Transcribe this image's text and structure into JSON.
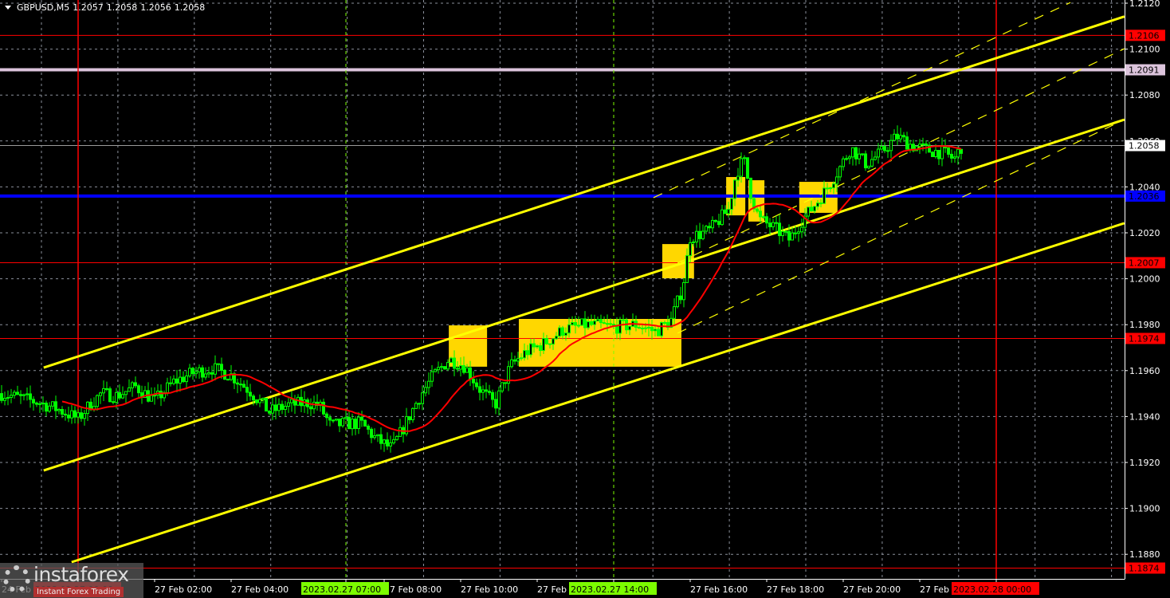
{
  "header": {
    "symbol": "GBPUSD,M5",
    "open": "1.2057",
    "high": "1.2058",
    "low": "1.2056",
    "close": "1.2058"
  },
  "logo": {
    "name": "instaforex",
    "tagline": "Instant Forex Trading"
  },
  "colors": {
    "background": "#000000",
    "bull": "#00ff00",
    "ma": "#ff0000",
    "channel": "#ffff00",
    "zone": "#ffd700",
    "grid": "#8a8f9a",
    "level_red": "#ff0000",
    "level_pink": "#dcc4dc",
    "level_blue": "#0000ff",
    "level_gray": "#9a9a9a"
  },
  "chart_data": {
    "type": "candlestick",
    "title": "GBPUSD,M5",
    "timeframe_minutes": 5,
    "x_unit": "hours from 2023.02.27 00:00",
    "ylim": [
      1.1866,
      1.2122
    ],
    "y_ticks": [
      "1.2120",
      "1.2100",
      "1.2080",
      "1.2060",
      "1.2040",
      "1.2020",
      "1.2000",
      "1.1980",
      "1.1960",
      "1.1940",
      "1.1920",
      "1.1900",
      "1.1880"
    ],
    "x_labels": [
      {
        "t": -2.0,
        "text": "24 Feb",
        "style": "plain"
      },
      {
        "t": 0.0,
        "text": "2023.02.27 00:00",
        "style": "red"
      },
      {
        "t": 2.0,
        "text": "27 Feb 02:00",
        "style": "plain"
      },
      {
        "t": 4.0,
        "text": "27 Feb 04:00",
        "style": "plain"
      },
      {
        "t": 8.0,
        "text": "27 Feb 08:00",
        "style": "plain"
      },
      {
        "t": 7.0,
        "text": "2023.02.27 07:00",
        "style": "green"
      },
      {
        "t": 10.0,
        "text": "27 Feb 10:00",
        "style": "plain"
      },
      {
        "t": 12.0,
        "text": "27 Feb 12:00",
        "style": "plain"
      },
      {
        "t": 14.0,
        "text": "2023.02.27 14:00",
        "style": "green"
      },
      {
        "t": 16.0,
        "text": "27 Feb 16:00",
        "style": "plain"
      },
      {
        "t": 18.0,
        "text": "27 Feb 18:00",
        "style": "plain"
      },
      {
        "t": 20.0,
        "text": "27 Feb 20:00",
        "style": "plain"
      },
      {
        "t": 22.0,
        "text": "27 Feb 22:00",
        "style": "plain"
      },
      {
        "t": 24.0,
        "text": "2023.02.28 00:00",
        "style": "red"
      }
    ],
    "close_path": [
      [
        -2.0,
        1.195
      ],
      [
        -1.5,
        1.1948
      ],
      [
        -1.0,
        1.1946
      ],
      [
        -0.5,
        1.1943
      ],
      [
        0.0,
        1.1939
      ],
      [
        0.3,
        1.1945
      ],
      [
        0.6,
        1.195
      ],
      [
        1.0,
        1.1949
      ],
      [
        1.5,
        1.1953
      ],
      [
        2.0,
        1.1947
      ],
      [
        2.5,
        1.1955
      ],
      [
        3.0,
        1.1959
      ],
      [
        3.5,
        1.1961
      ],
      [
        4.0,
        1.1958
      ],
      [
        4.5,
        1.1951
      ],
      [
        5.0,
        1.1942
      ],
      [
        5.5,
        1.1945
      ],
      [
        6.0,
        1.1946
      ],
      [
        6.3,
        1.1945
      ],
      [
        6.6,
        1.1936
      ],
      [
        7.0,
        1.1937
      ],
      [
        7.4,
        1.1937
      ],
      [
        7.8,
        1.193
      ],
      [
        8.2,
        1.1926
      ],
      [
        8.5,
        1.1935
      ],
      [
        8.9,
        1.1948
      ],
      [
        9.3,
        1.1958
      ],
      [
        9.7,
        1.1965
      ],
      [
        10.1,
        1.1962
      ],
      [
        10.5,
        1.1952
      ],
      [
        10.9,
        1.1945
      ],
      [
        11.3,
        1.1962
      ],
      [
        11.7,
        1.1968
      ],
      [
        12.2,
        1.1972
      ],
      [
        12.7,
        1.1978
      ],
      [
        13.3,
        1.198
      ],
      [
        14.0,
        1.1979
      ],
      [
        14.6,
        1.198
      ],
      [
        15.1,
        1.1977
      ],
      [
        15.5,
        1.1982
      ],
      [
        15.8,
        1.1996
      ],
      [
        16.0,
        1.2018
      ],
      [
        16.5,
        1.2021
      ],
      [
        17.0,
        1.203
      ],
      [
        17.2,
        1.2046
      ],
      [
        17.4,
        1.2052
      ],
      [
        17.6,
        1.2036
      ],
      [
        17.8,
        1.2026
      ],
      [
        18.2,
        1.2022
      ],
      [
        18.6,
        1.2017
      ],
      [
        18.9,
        1.2025
      ],
      [
        19.3,
        1.2033
      ],
      [
        19.6,
        1.204
      ],
      [
        19.9,
        1.2048
      ],
      [
        20.2,
        1.2057
      ],
      [
        20.6,
        1.205
      ],
      [
        21.0,
        1.2055
      ],
      [
        21.4,
        1.2062
      ],
      [
        21.8,
        1.2058
      ],
      [
        22.2,
        1.2056
      ],
      [
        22.6,
        1.2055
      ],
      [
        22.9,
        1.2052
      ],
      [
        23.1,
        1.2058
      ]
    ],
    "moving_average_period": 20,
    "price_levels": [
      {
        "price": 1.2106,
        "label": "1.2106",
        "color": "#ff0000",
        "weight": "thin",
        "label_text": "#000000"
      },
      {
        "price": 1.2091,
        "label": "1.2091",
        "color": "#dcc4dc",
        "weight": "thick",
        "label_text": "#000000"
      },
      {
        "price": 1.2058,
        "label": "1.2058",
        "color": "#9a9a9a",
        "weight": "thin",
        "label_bg": "#ffffff",
        "label_text": "#000000"
      },
      {
        "price": 1.2036,
        "label": "1.2036",
        "color": "#0000ff",
        "weight": "thick",
        "label_text": "#000000"
      },
      {
        "price": 1.2007,
        "label": "1.2007",
        "color": "#ff0000",
        "weight": "thin",
        "label_text": "#000000"
      },
      {
        "price": 1.1974,
        "label": "1.1974",
        "color": "#ff0000",
        "weight": "thin",
        "label_text": "#000000"
      },
      {
        "price": 1.1874,
        "label": "1.1874",
        "color": "#ff0000",
        "weight": "thin",
        "label_text": "#000000"
      }
    ],
    "vertical_markers": [
      {
        "t": 0.0,
        "color": "#ff0000",
        "style": "solid"
      },
      {
        "t": 24.0,
        "color": "#ff0000",
        "style": "solid"
      },
      {
        "t": 7.0,
        "color": "#7cfc00",
        "style": "dashed"
      },
      {
        "t": 14.0,
        "color": "#7cfc00",
        "style": "dashed"
      }
    ],
    "trend_lines": [
      {
        "name": "channel-upper",
        "p1": [
          -0.9,
          1.19613
        ],
        "p2": [
          27.35,
          1.21142
        ],
        "style": "solid"
      },
      {
        "name": "channel-middle",
        "p1": [
          -0.9,
          1.19165
        ],
        "p2": [
          27.35,
          1.20693
        ],
        "style": "solid"
      },
      {
        "name": "channel-lower",
        "p1": [
          -0.17,
          1.18766
        ],
        "p2": [
          27.35,
          1.20242
        ],
        "style": "solid"
      },
      {
        "name": "fan-line-1",
        "p1": [
          15.04,
          1.20353
        ],
        "p2": [
          25.94,
          1.21203
        ],
        "style": "dashed"
      },
      {
        "name": "fan-line-2",
        "p1": [
          15.67,
          1.20068
        ],
        "p2": [
          27.35,
          1.21002
        ],
        "style": "dashed"
      },
      {
        "name": "fan-line-3",
        "p1": [
          15.67,
          1.19763
        ],
        "p2": [
          27.35,
          1.20693
        ],
        "style": "dashed"
      }
    ],
    "zones": [
      {
        "t1": 9.69,
        "t2": 10.69,
        "p1": 1.19797,
        "p2": 1.19617
      },
      {
        "t1": 11.52,
        "t2": 15.77,
        "p1": 1.19825,
        "p2": 1.19617
      },
      {
        "t1": 15.27,
        "t2": 16.1,
        "p1": 1.20151,
        "p2": 1.20002
      },
      {
        "t1": 16.94,
        "t2": 17.44,
        "p1": 1.20443,
        "p2": 1.20276
      },
      {
        "t1": 17.52,
        "t2": 17.94,
        "p1": 1.20429,
        "p2": 1.20249
      },
      {
        "t1": 18.85,
        "t2": 19.85,
        "p1": 1.20422,
        "p2": 1.20287
      }
    ]
  }
}
